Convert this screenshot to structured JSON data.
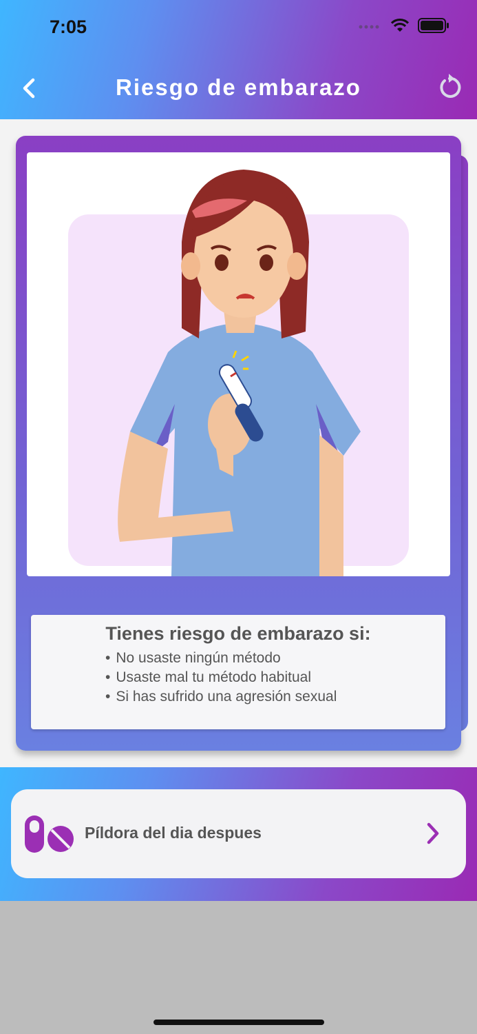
{
  "status_bar": {
    "time": "7:05"
  },
  "header": {
    "title": "Riesgo de embarazo"
  },
  "card": {
    "info_title": "Tienes riesgo de embarazo si:",
    "items": [
      "No usaste ningún método",
      "Usaste mal tu método habitual",
      "Si has sufrido una agresión sexual"
    ]
  },
  "action": {
    "label": "Píldora del dia despues"
  },
  "colors": {
    "accent_purple": "#9a2ab4",
    "accent_blue": "#3fb6ff",
    "pill_icon": "#9b2fb4"
  },
  "icons": [
    "back-arrow-icon",
    "reload-icon",
    "wifi-icon",
    "battery-icon",
    "pill-icon",
    "chevron-right-icon"
  ]
}
